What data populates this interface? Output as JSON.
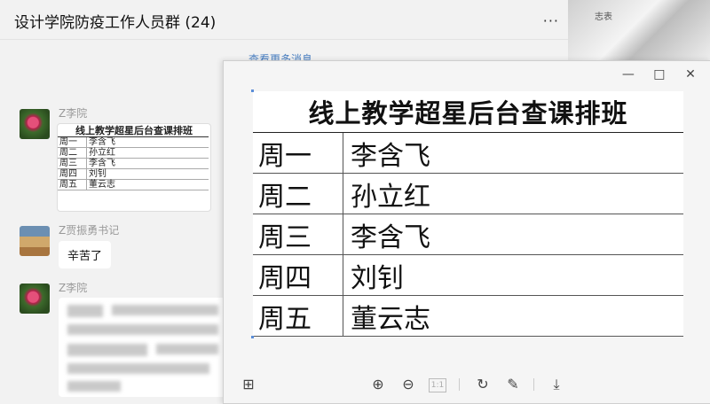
{
  "chat": {
    "title": "设计学院防疫工作人员群 (24)",
    "more_label": "···",
    "more_messages": "查看更多消息",
    "messages": [
      {
        "sender": "Z李院"
      },
      {
        "sender": "Z贾振勇书记",
        "text": "辛苦了"
      },
      {
        "sender": "Z李院"
      }
    ],
    "mini_table": {
      "title": "线上教学超星后台查课排班",
      "rows": [
        {
          "day": "周一",
          "name": "李含飞"
        },
        {
          "day": "周二",
          "name": "孙立红"
        },
        {
          "day": "周三",
          "name": "李含飞"
        },
        {
          "day": "周四",
          "name": "刘钊"
        },
        {
          "day": "周五",
          "name": "董云志"
        }
      ]
    }
  },
  "viewer": {
    "schedule": {
      "title": "线上教学超星后台查课排班",
      "rows": [
        {
          "day": "周一",
          "name": "李含飞"
        },
        {
          "day": "周二",
          "name": "孙立红"
        },
        {
          "day": "周三",
          "name": " 李含飞"
        },
        {
          "day": "周四",
          "name": "刘钊"
        },
        {
          "day": "周五",
          "name": "董云志"
        }
      ]
    },
    "controls": {
      "minimize": "—",
      "maximize": "□",
      "close": "✕"
    },
    "toolbar": {
      "grid": "⊞",
      "zoom_in": "⊕",
      "zoom_out": "⊖",
      "actual_size": "1:1",
      "rotate": "↻",
      "edit": "✎",
      "download": "⤓"
    }
  },
  "background": {
    "paper_text": "志表"
  }
}
